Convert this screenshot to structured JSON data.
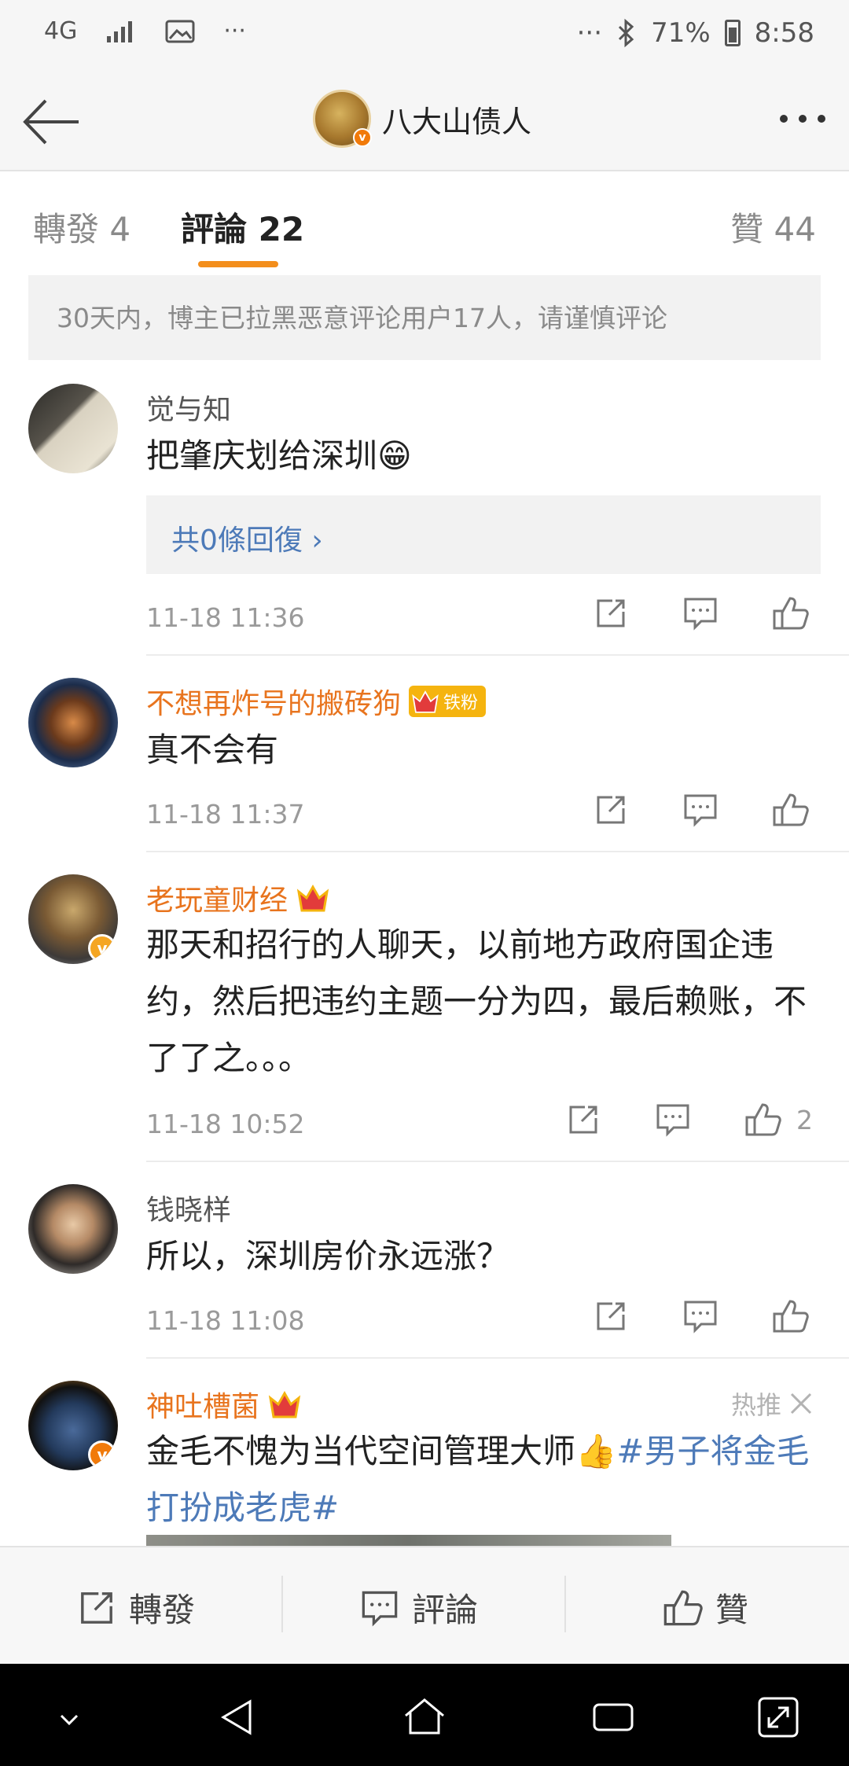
{
  "status_bar": {
    "network": "4G",
    "more_left": "···",
    "more_right": "···",
    "battery": "71%",
    "time": "8:58"
  },
  "header": {
    "title": "八大山债人",
    "verified_badge": "v"
  },
  "tabs": [
    {
      "label": "轉發 4"
    },
    {
      "label": "評論 22"
    },
    {
      "label": "贊 44"
    }
  ],
  "notice": "30天内，博主已拉黑恶意评论用户17人，请谨慎评论",
  "comments": [
    {
      "user": "觉与知",
      "text": "把肇庆划给深圳😁",
      "replies": "共0條回復",
      "time": "11-18 11:36",
      "likes": ""
    },
    {
      "user": "不想再炸号的搬砖狗",
      "fan_badge": "铁粉",
      "text": "真不会有",
      "time": "11-18 11:37",
      "likes": ""
    },
    {
      "user": "老玩童财经",
      "verified_badge": "v",
      "text": "那天和招行的人聊天，以前地方政府国企违约，然后把违约主题一分为四，最后赖账，不了了之。。。",
      "time": "11-18 10:52",
      "likes": "2"
    },
    {
      "user": "钱晓样",
      "text": "所以，深圳房价永远涨？",
      "time": "11-18 11:08",
      "likes": ""
    },
    {
      "user": "神吐槽菌",
      "verified_badge": "v",
      "hot_label": "热推",
      "text_before": "金毛不愧为当代空间管理大师👍",
      "text_tag": "#男子将金毛打扮成老虎#"
    }
  ],
  "bottom_bar": {
    "repost": "轉發",
    "comment": "評論",
    "like": "贊"
  },
  "colors": {
    "accent": "#f38e1c",
    "link": "#4d7ab8",
    "username_orange": "#e8741e"
  }
}
